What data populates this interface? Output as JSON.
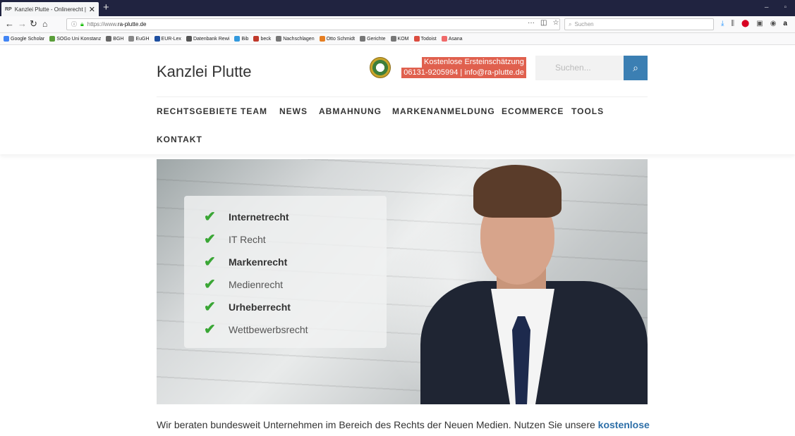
{
  "browser": {
    "tab_title": "Kanzlei Plutte - Onlinerecht | IT",
    "tab_favicon": "RP",
    "url_prefix": "https://www.",
    "url_domain": "ra-plutte.de",
    "search_placeholder": "Suchen",
    "new_tab_icon": "+",
    "bookmarks": [
      {
        "label": "Google Scholar",
        "color": "#4285f4"
      },
      {
        "label": "SOGo Uni Konstanz",
        "color": "#5a9e3a"
      },
      {
        "label": "BGH",
        "color": "#666666"
      },
      {
        "label": "EuGH",
        "color": "#888888"
      },
      {
        "label": "EUR-Lex",
        "color": "#1e4fa0"
      },
      {
        "label": "Datenbank Rewi",
        "color": "#555555"
      },
      {
        "label": "Bib",
        "color": "#3399dd"
      },
      {
        "label": "beck",
        "color": "#c0392b"
      },
      {
        "label": "Nachschlagen",
        "color": "#777777"
      },
      {
        "label": "Otto Schmidt",
        "color": "#e67e22"
      },
      {
        "label": "Gerichte",
        "color": "#777777"
      },
      {
        "label": "KOM",
        "color": "#777777"
      },
      {
        "label": "Todoist",
        "color": "#db4c3f"
      },
      {
        "label": "Asana",
        "color": "#f06a6a"
      }
    ]
  },
  "site": {
    "brand": "Kanzlei Plutte",
    "contact_line1": "Kostenlose Ersteinschätzung",
    "contact_line2": "06131-9205994 | info@ra-plutte.de",
    "search_placeholder": "Suchen...",
    "menu": [
      "RECHTSGEBIETE",
      "TEAM",
      "NEWS",
      "ABMAHNUNG",
      "MARKENANMELDUNG",
      "ECOMMERCE",
      "TOOLS",
      "KONTAKT"
    ],
    "hero_items": [
      "Internetrecht",
      "IT Recht",
      "Markenrecht",
      "Medienrecht",
      "Urheberrecht",
      "Wettbewerbsrecht"
    ],
    "intro_text": "Wir beraten bundesweit Unternehmen im Bereich des Rechts der Neuen Medien. Nutzen Sie unsere ",
    "intro_link": "kostenlose"
  },
  "colors": {
    "accent_blue": "#3b7fb3",
    "contact_red": "#e0604e",
    "check_green": "#3aa635"
  }
}
